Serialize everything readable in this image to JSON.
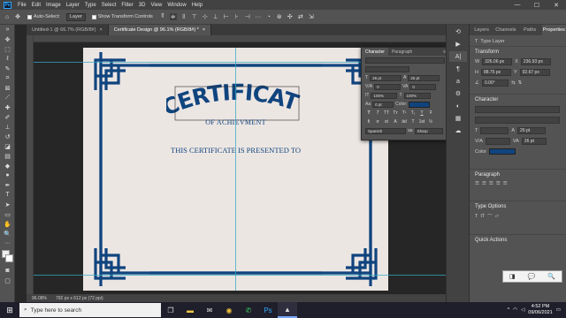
{
  "menu": {
    "app_icon": "Ps",
    "items": [
      "File",
      "Edit",
      "Image",
      "Layer",
      "Type",
      "Select",
      "Filter",
      "3D",
      "View",
      "Window",
      "Help"
    ],
    "window_controls": [
      "—",
      "☐",
      "✕"
    ]
  },
  "options": {
    "auto_select_label": "Auto-Select:",
    "layer_select": "Layer",
    "show_transform_label": "Show Transform Controls"
  },
  "tabs": [
    {
      "label": "Untitled-1 @ 66.7% (RGB/8#)",
      "close": "×"
    },
    {
      "label": "Certificate Design @ 96.1% (RGB/8#) *",
      "close": "×"
    }
  ],
  "certificate": {
    "title": "CERTIFICATE",
    "subtitle": "OF ACHIEVMENT",
    "presented": "THIS CERTIFICATE IS PRESENTED TO",
    "border_color": "#10447e",
    "paper_color": "#ece6e3"
  },
  "status": {
    "zoom": "96.08%",
    "doc_size": "792 px x 612 px (72 ppi)"
  },
  "char_panel": {
    "tabs": [
      "Character",
      "Paragraph"
    ],
    "size": "26 pt",
    "leading": "26 pt",
    "tracking": "0",
    "kerning": "0",
    "vscale": "100%",
    "hscale": "100%",
    "baseline": "0 pt",
    "color_label": "Color:",
    "color": "#10447e",
    "type_buttons": [
      "T",
      "T",
      "TT",
      "Tт",
      "T¹",
      "T₁",
      "T",
      "Ŧ"
    ],
    "ot_buttons": [
      "fi",
      "σ",
      "st",
      "A",
      "ād",
      "T",
      "1st",
      "½"
    ],
    "language": "Spanish",
    "aa_label": "aa",
    "antialias": "Sharp"
  },
  "right_panel": {
    "tabs": [
      "Layers",
      "Channels",
      "Paths",
      "Properties"
    ],
    "layer_kind": "Type Layer",
    "transform_title": "Transform",
    "w_label": "W",
    "w": "326.06 px",
    "x_label": "X",
    "x": "236.93 px",
    "h_label": "H",
    "h": "88.75 px",
    "y_label": "Y",
    "y": "92.67 px",
    "angle": "0.00°",
    "character_title": "Character",
    "size": "26 pt",
    "leading": "26 pt",
    "color_label": "Color",
    "color": "#10447e",
    "paragraph_title": "Paragraph",
    "type_options_title": "Type Options",
    "quick_actions_title": "Quick Actions"
  },
  "taskbar": {
    "search_placeholder": "Type here to search",
    "time": "4:52 PM",
    "date": "09/06/2021"
  },
  "notification": [
    "◨",
    "💬",
    "🔍"
  ]
}
